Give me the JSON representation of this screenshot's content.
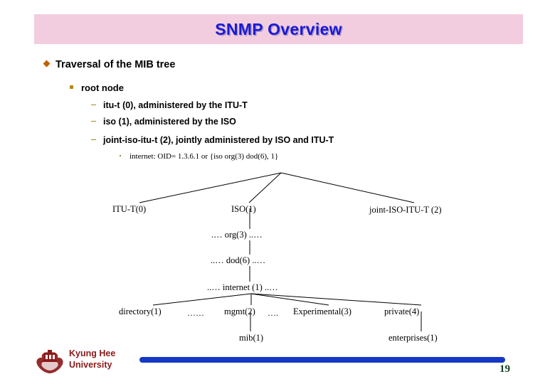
{
  "slide": {
    "title": "SNMP Overview",
    "title_bg_color": "#f2cddf",
    "title_color": "#1a1ad4",
    "page_number": "19"
  },
  "outline": {
    "level1": "Traversal of the MIB tree",
    "level2": "root node",
    "level3": [
      "itu-t (0), administered by the ITU-T",
      "iso (1), administered by the ISO",
      "joint-iso-itu-t (2), jointly administered by ISO and ITU-T"
    ],
    "level4": "internet: OID= 1.3.6.1 or {iso org(3) dod(6), 1}"
  },
  "tree": {
    "nodes": {
      "itut": "ITU-T(0)",
      "iso": "ISO(1)",
      "joint": "joint-ISO-ITU-T (2)",
      "org": ".…  org(3) ..…",
      "dod": "..… dod(6) ..…",
      "internet": "..… internet (1) ..…",
      "directory": "directory(1)",
      "dots1": "……",
      "mgmt": "mgmt(2)",
      "dots2": "….",
      "experimental": "Experimental(3)",
      "private": "private(4)",
      "mib": "mib(1)",
      "enterprises": "enterprises(1)"
    },
    "line_color": "#000000"
  },
  "footer": {
    "institution_line1": "Kyung Hee",
    "institution_line2": "University",
    "bar_color": "#1639c4",
    "logo_color": "#8c1a1a"
  }
}
